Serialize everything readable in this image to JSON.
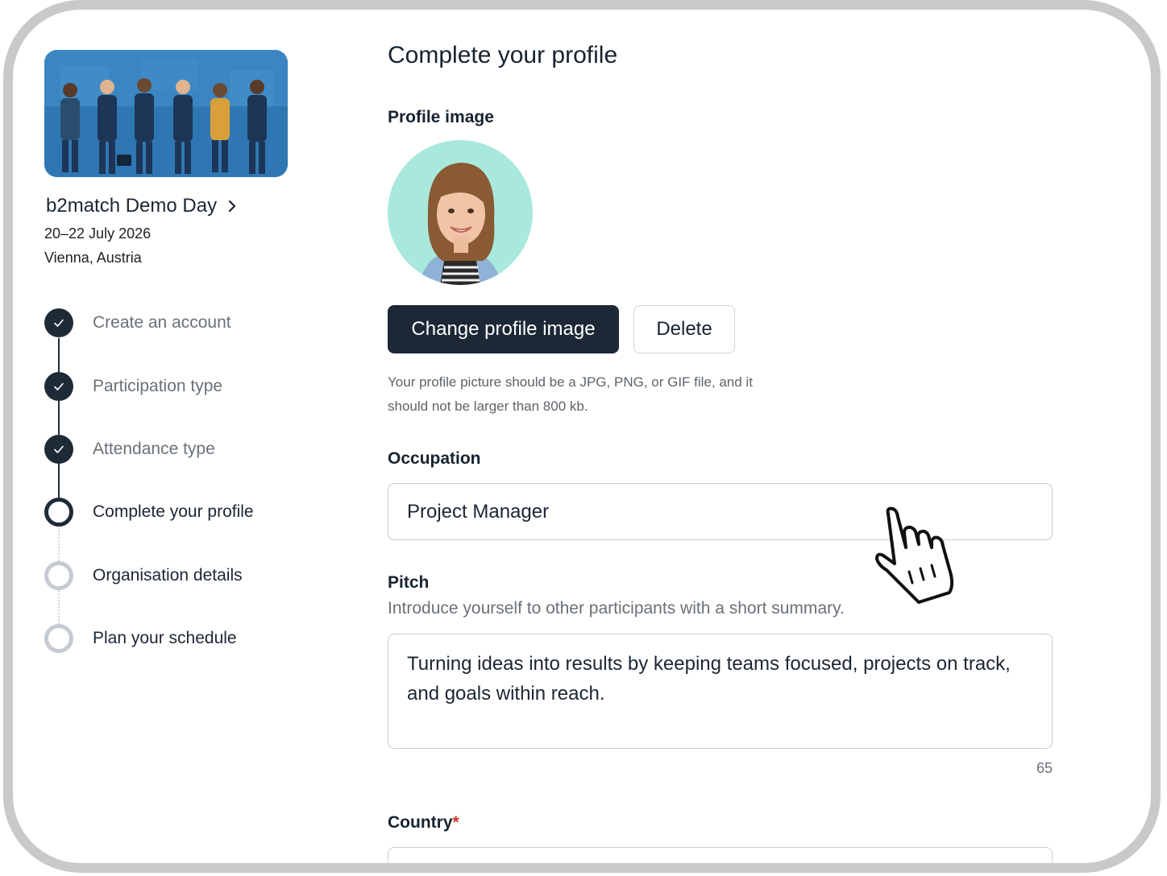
{
  "event": {
    "title": "b2match Demo Day",
    "date": "20–22 July 2026",
    "location": "Vienna, Austria"
  },
  "steps": [
    {
      "label": "Create an account",
      "status": "done"
    },
    {
      "label": "Participation type",
      "status": "done"
    },
    {
      "label": "Attendance type",
      "status": "done"
    },
    {
      "label": "Complete your profile",
      "status": "current"
    },
    {
      "label": "Organisation details",
      "status": "todo"
    },
    {
      "label": "Plan your schedule",
      "status": "todo"
    }
  ],
  "main": {
    "title": "Complete your profile",
    "profile_image": {
      "label": "Profile image",
      "change_button": "Change profile image",
      "delete_button": "Delete",
      "hint": "Your profile picture should be a JPG, PNG, or GIF file, and it should not be larger than 800 kb."
    },
    "occupation": {
      "label": "Occupation",
      "value": "Project Manager"
    },
    "pitch": {
      "label": "Pitch",
      "description": "Introduce yourself to other participants with a short summary.",
      "value": "Turning ideas into results by keeping teams focused, projects on track, and goals within reach.",
      "char_count": "65"
    },
    "country": {
      "label": "Country",
      "required_mark": "*"
    }
  },
  "colors": {
    "primary": "#1c2836",
    "muted_text": "#6a7178",
    "step_todo": "#c5cbd1",
    "avatar_bg": "#a9e9dd",
    "required": "#d0342c"
  }
}
